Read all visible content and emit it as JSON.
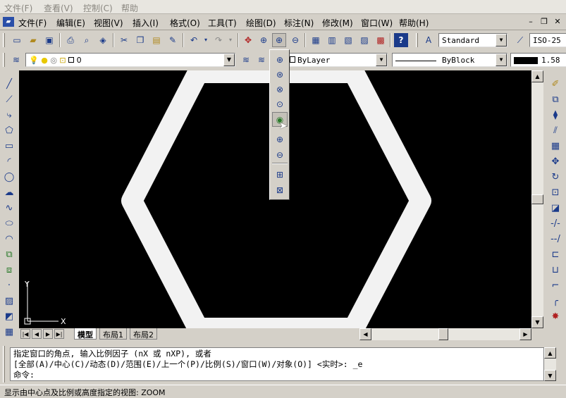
{
  "top_menu": [
    "文件(F)",
    "查看(V)",
    "控制(C)",
    "帮助"
  ],
  "menubar": [
    "文件(F)",
    "编辑(E)",
    "视图(V)",
    "插入(I)",
    "格式(O)",
    "工具(T)",
    "绘图(D)",
    "标注(N)",
    "修改(M)",
    "窗口(W)",
    "帮助(H)"
  ],
  "styles": {
    "text_style": "Standard",
    "dim_style": "ISO-25"
  },
  "layer_toolbar": {
    "layer_name": "0",
    "color": "ByLayer",
    "linetype": "ByBlock",
    "lineweight": "1.58"
  },
  "tabs": [
    "模型",
    "布局1",
    "布局2"
  ],
  "command_lines": [
    "指定窗口的角点, 输入比例因子 (nX 或 nXP), 或者",
    "[全部(A)/中心(C)/动态(D)/范围(E)/上一个(P)/比例(S)/窗口(W)/对象(O)] <实时>: _e",
    "命令:"
  ],
  "status_text": "显示由中心点及比例或高度指定的视图:  ZOOM",
  "ucs": {
    "x_label": "X",
    "y_label": "Y"
  },
  "colors": {
    "canvas": "#000000",
    "hexagon": "#f2f2f2",
    "chrome": "#d4d0c8"
  }
}
